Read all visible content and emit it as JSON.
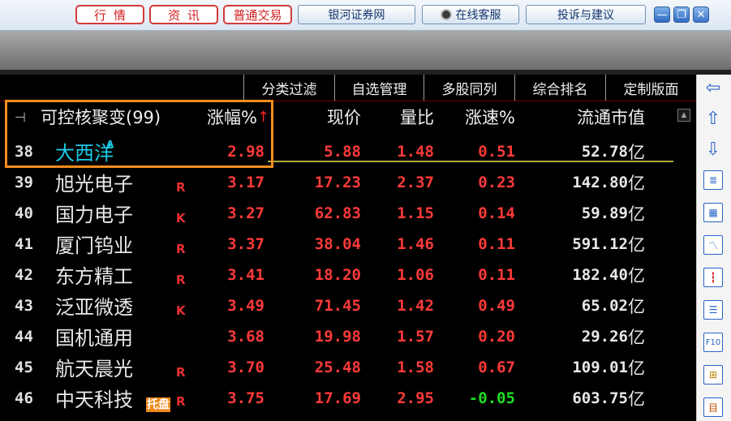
{
  "toolbar": {
    "hangqing": "行情",
    "zixun": "资讯",
    "putong": "普通交易",
    "yinhe": "银河证券网",
    "zaixian": "在线客服",
    "tousu": "投诉与建议"
  },
  "menu": [
    "分类过滤",
    "自选管理",
    "多股同列",
    "综合排名",
    "定制版面"
  ],
  "header": {
    "title": "可控核聚变(99)",
    "change_pct": "涨幅%",
    "price": "现价",
    "volume_ratio": "量比",
    "speed": "涨速%",
    "mcap": "流通市值"
  },
  "unit": "亿",
  "rows": [
    {
      "idx": "38",
      "name": "大西洋",
      "flag": "A",
      "chg": "2.98",
      "price": "5.88",
      "vr": "1.48",
      "speed": "0.51",
      "mcap": "52.78"
    },
    {
      "idx": "39",
      "name": "旭光电子",
      "flag": "R",
      "chg": "3.17",
      "price": "17.23",
      "vr": "2.37",
      "speed": "0.23",
      "mcap": "142.80"
    },
    {
      "idx": "40",
      "name": "国力电子",
      "flag": "K",
      "chg": "3.27",
      "price": "62.83",
      "vr": "1.15",
      "speed": "0.14",
      "mcap": "59.89"
    },
    {
      "idx": "41",
      "name": "厦门钨业",
      "flag": "R",
      "chg": "3.37",
      "price": "38.04",
      "vr": "1.46",
      "speed": "0.11",
      "mcap": "591.12"
    },
    {
      "idx": "42",
      "name": "东方精工",
      "flag": "R",
      "chg": "3.41",
      "price": "18.20",
      "vr": "1.06",
      "speed": "0.11",
      "mcap": "182.40"
    },
    {
      "idx": "43",
      "name": "泛亚微透",
      "flag": "K",
      "chg": "3.49",
      "price": "71.45",
      "vr": "1.42",
      "speed": "0.49",
      "mcap": "65.02"
    },
    {
      "idx": "44",
      "name": "国机通用",
      "flag": "",
      "chg": "3.68",
      "price": "19.98",
      "vr": "1.57",
      "speed": "0.20",
      "mcap": "29.26"
    },
    {
      "idx": "45",
      "name": "航天晨光",
      "flag": "R",
      "chg": "3.70",
      "price": "25.48",
      "vr": "1.58",
      "speed": "0.67",
      "mcap": "109.01"
    },
    {
      "idx": "46",
      "name": "中天科技",
      "flag": "R",
      "tag": "托盘",
      "chg": "3.75",
      "price": "17.69",
      "vr": "2.95",
      "speed": "-0.05",
      "mcap": "603.75"
    }
  ],
  "colors": {
    "up": "#ff3a3a",
    "down": "#22dd22",
    "highlight": "#f28c1f",
    "selected_name": "#1ecbe8"
  }
}
